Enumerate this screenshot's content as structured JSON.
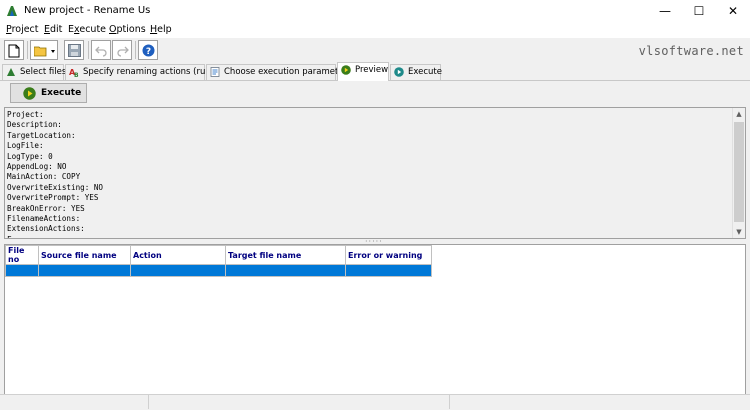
{
  "window": {
    "title": "New project - Rename Us",
    "minimize": "—",
    "maximize": "☐",
    "close": "✕"
  },
  "menu": [
    {
      "label": "Project",
      "accel": "P",
      "rest": "roject"
    },
    {
      "label": "Edit",
      "accel": "E",
      "rest": "dit"
    },
    {
      "label": "Execute",
      "accel": "x",
      "pre": "E",
      "rest": "ecute"
    },
    {
      "label": "Options",
      "accel": "O",
      "rest": "ptions"
    },
    {
      "label": "Help",
      "accel": "H",
      "rest": "elp"
    }
  ],
  "toolbar": {
    "brand": "vlsoftware.net"
  },
  "tabs": [
    {
      "label": "Select files"
    },
    {
      "label": "Specify renaming actions (rules)"
    },
    {
      "label": "Choose execution parameters"
    },
    {
      "label": "Preview"
    },
    {
      "label": "Execute"
    }
  ],
  "execute_button": {
    "label": "Execute"
  },
  "log_lines": [
    "Project:",
    "Description:",
    "TargetLocation:",
    "LogFile:",
    "LogType: 0",
    "AppendLog: NO",
    "MainAction: COPY",
    "OverwriteExisting: NO",
    "OverwritePrompt: YES",
    "BreakOnError: YES",
    "FilenameActions:",
    "ExtensionActions:",
    "F..."
  ],
  "grid": {
    "columns": [
      "File no",
      "Source file name",
      "Action",
      "Target file name",
      "Error or warning"
    ]
  },
  "colors": {
    "selection": "#0078d7",
    "header_text": "#000080"
  }
}
